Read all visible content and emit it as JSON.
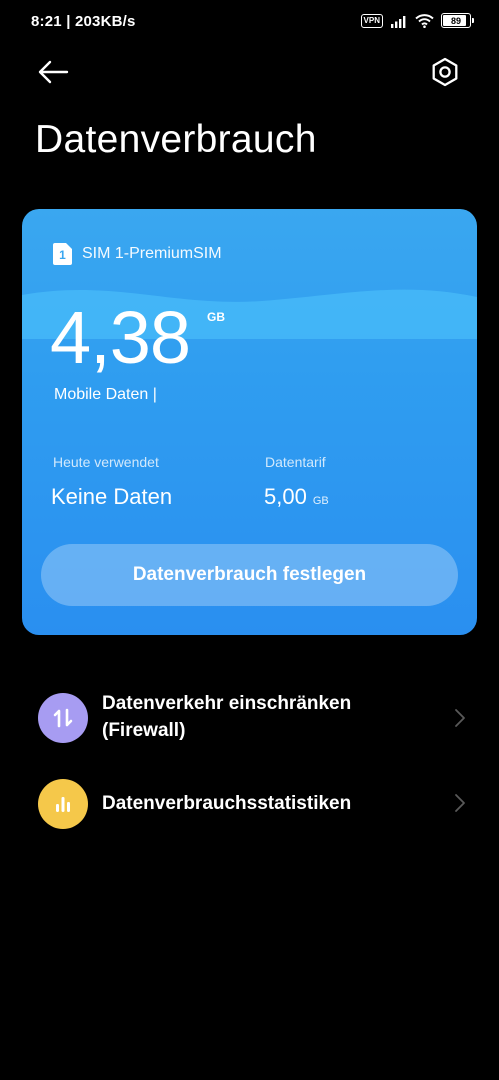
{
  "status_bar": {
    "time_speed": "8:21 | 203KB/s",
    "vpn": "VPN",
    "battery": "89",
    "battery_level": 0.89
  },
  "header": {
    "title": "Datenverbrauch",
    "back_icon": "back-arrow-icon",
    "settings_icon": "settings-hexagon-icon"
  },
  "card": {
    "sim_label": "SIM 1-PremiumSIM",
    "sim_number": "1",
    "usage_value": "4,38",
    "usage_unit": "GB",
    "usage_caption": "Mobile Daten |",
    "today_label": "Heute verwendet",
    "today_value": "Keine Daten",
    "plan_label": "Datentarif",
    "plan_value": "5,00",
    "plan_unit": "GB",
    "set_button": "Datenverbrauch festlegen",
    "colors": {
      "top": "#3aa7f0",
      "bottom": "#2a8ff0",
      "wave": "#4cc0fb"
    }
  },
  "menu": [
    {
      "label_line1": "Datenverkehr einschränken",
      "label_line2": "(Firewall)",
      "icon": "up-down-arrows-icon",
      "icon_color": "#a79cf2"
    },
    {
      "label": "Datenverbrauchsstatistiken",
      "icon": "bar-chart-icon",
      "icon_color": "#f5c84a"
    }
  ]
}
